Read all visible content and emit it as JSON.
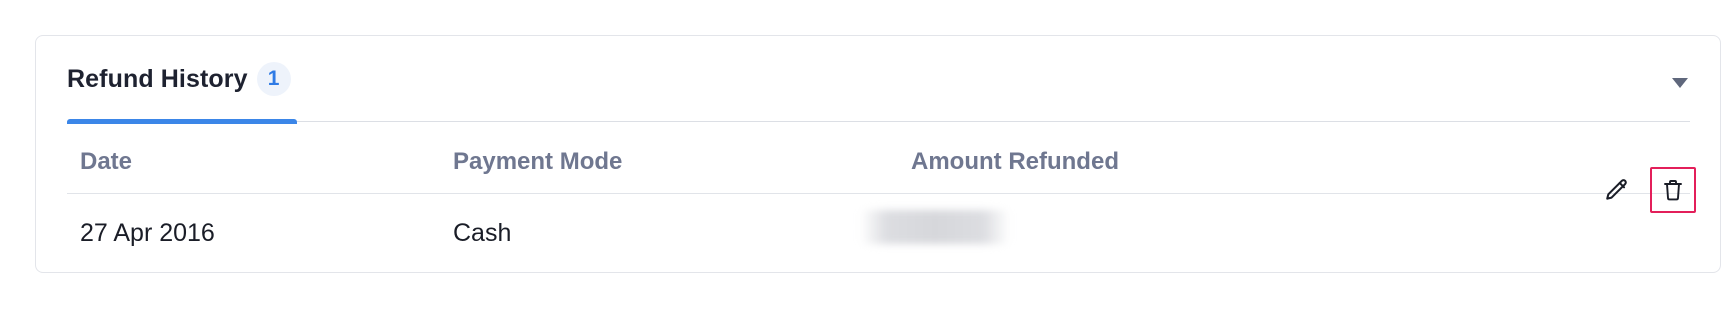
{
  "refund_history": {
    "title": "Refund History",
    "count": "1",
    "collapse_icon": "caret-down-icon",
    "columns": {
      "date": "Date",
      "payment_mode": "Payment Mode",
      "amount_refunded": "Amount Refunded"
    },
    "rows": [
      {
        "date": "27 Apr 2016",
        "payment_mode": "Cash",
        "amount_refunded_note": "blurred",
        "actions": [
          "pencil-icon",
          "trash-icon"
        ]
      }
    ]
  },
  "colors": {
    "accent": "#3b86e8",
    "count_text": "#2f7be5",
    "count_bg": "#eef3fb",
    "header_text": "#6f7790",
    "highlight_border": "#e31f5a"
  }
}
